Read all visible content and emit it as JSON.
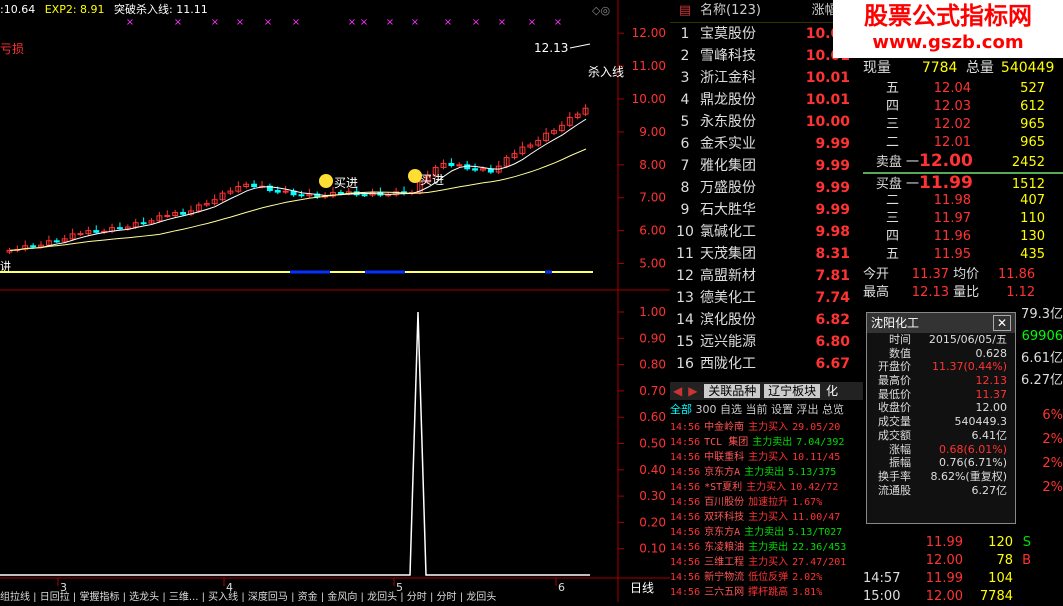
{
  "indicator": {
    "p1": ":10.64",
    "exp2": "EXP2: 8.91",
    "break_line": "突破杀入线: 11.11",
    "left_tag": "亏损"
  },
  "chart_data": {
    "type": "candlestick",
    "price_axis": [
      "12.00",
      "11.00",
      "10.00",
      "9.00",
      "8.00",
      "7.00",
      "6.00",
      "5.00"
    ],
    "ylim": [
      4.5,
      12.4
    ],
    "osc_axis": [
      "1.00",
      "0.90",
      "0.80",
      "0.70",
      "0.60",
      "0.50",
      "0.40",
      "0.30",
      "0.20",
      "0.10"
    ],
    "high_label": "12.13",
    "annotations": [
      "买进",
      "买进",
      "杀入线"
    ],
    "left_marker": "讲",
    "x_labels": [
      "3",
      "4",
      "5",
      "6"
    ],
    "period_label": "日线",
    "bottom_tabs": "组拉线 | 日回拉 | 掌握指标 | 选龙头 | 三维... | 买入线 | 深度回马 | 资金 | 金风向 | 龙回头 | 分时 | 分时 | 龙回头"
  },
  "watchlist": {
    "header_name": "名称(123)",
    "header_pct": "涨幅%",
    "rows": [
      {
        "n": "1",
        "name": "宝莫股份",
        "pct": "10.03"
      },
      {
        "n": "2",
        "name": "雪峰科技",
        "pct": "10.01"
      },
      {
        "n": "3",
        "name": "浙江金科",
        "pct": "10.01"
      },
      {
        "n": "4",
        "name": "鼎龙股份",
        "pct": "10.01"
      },
      {
        "n": "5",
        "name": "永东股份",
        "pct": "10.00"
      },
      {
        "n": "6",
        "name": "金禾实业",
        "pct": "9.99"
      },
      {
        "n": "7",
        "name": "雅化集团",
        "pct": "9.99"
      },
      {
        "n": "8",
        "name": "万盛股份",
        "pct": "9.99"
      },
      {
        "n": "9",
        "name": "石大胜华",
        "pct": "9.99"
      },
      {
        "n": "10",
        "name": "氯碱化工",
        "pct": "9.98"
      },
      {
        "n": "11",
        "name": "天茂集团",
        "pct": "8.31"
      },
      {
        "n": "12",
        "name": "高盟新材",
        "pct": "7.81"
      },
      {
        "n": "13",
        "name": "德美化工",
        "pct": "7.74"
      },
      {
        "n": "14",
        "name": "滨化股份",
        "pct": "6.82"
      },
      {
        "n": "15",
        "name": "远兴能源",
        "pct": "6.80"
      },
      {
        "n": "16",
        "name": "西陇化工",
        "pct": "6.67"
      }
    ]
  },
  "tabs": {
    "t1": "关联品种",
    "t2": "辽宁板块",
    "t3": "化"
  },
  "subtabs": {
    "a": "全部",
    "b": "300",
    "c": "自选",
    "d": "当前",
    "e": "设置",
    "f": "浮出",
    "g": "总览"
  },
  "ticks": [
    {
      "t": "14:56",
      "s": "中金岭南",
      "a": "主力买入",
      "v": "29.05/20"
    },
    {
      "t": "14:56",
      "s": "TCL 集团",
      "a": "主力卖出",
      "v": "7.04/392"
    },
    {
      "t": "14:56",
      "s": "中联重科",
      "a": "主力买入",
      "v": "10.11/45"
    },
    {
      "t": "14:56",
      "s": "京东方A",
      "a": "主力卖出",
      "v": "5.13/375"
    },
    {
      "t": "14:56",
      "s": "*ST夏利",
      "a": "主力买入",
      "v": "10.42/72"
    },
    {
      "t": "14:56",
      "s": "百川股份",
      "a": "加速拉升",
      "v": "1.67%"
    },
    {
      "t": "14:56",
      "s": "双环科技",
      "a": "主力买入",
      "v": "11.00/47"
    },
    {
      "t": "14:56",
      "s": "京东方A",
      "a": "主力卖出",
      "v": "5.13/T027"
    },
    {
      "t": "14:56",
      "s": "东凌粮油",
      "a": "主力卖出",
      "v": "22.36/453"
    },
    {
      "t": "14:56",
      "s": "三维工程",
      "a": "主力买入",
      "v": "27.47/201"
    },
    {
      "t": "14:56",
      "s": "新宁物流",
      "a": "低位反弹",
      "v": "2.02%"
    },
    {
      "t": "14:56",
      "s": "三六五网",
      "a": "撑杆跳高",
      "v": "3.81%"
    }
  ],
  "banner": {
    "title": "股票公式指标网",
    "url": "www.gszb.com"
  },
  "quote": {
    "now_vol_label": "现量",
    "now_vol": "7784",
    "total_label": "总量",
    "total": "540449",
    "sell": [
      {
        "l": "五",
        "p": "12.04",
        "v": "527"
      },
      {
        "l": "四",
        "p": "12.03",
        "v": "612"
      },
      {
        "l": "三",
        "p": "12.02",
        "v": "965"
      },
      {
        "l": "二",
        "p": "12.01",
        "v": "965"
      },
      {
        "l": "卖盘 一",
        "p": "12.00",
        "v": "2452"
      }
    ],
    "buy": [
      {
        "l": "买盘 一",
        "p": "11.99",
        "v": "1512"
      },
      {
        "l": "二",
        "p": "11.98",
        "v": "407"
      },
      {
        "l": "三",
        "p": "11.97",
        "v": "110"
      },
      {
        "l": "四",
        "p": "11.96",
        "v": "130"
      },
      {
        "l": "五",
        "p": "11.95",
        "v": "435"
      }
    ],
    "open_label": "今开",
    "open": "11.37",
    "avg_label": "均价",
    "avg": "11.86",
    "high_label": "最高",
    "high": "12.13",
    "ratio_label": "量比",
    "ratio": "1.12",
    "side": [
      "79.3亿",
      "69906",
      "6.61亿",
      "6.27亿"
    ],
    "right_pct": [
      "6%",
      "2%",
      "2%",
      "2%"
    ],
    "bottom_ticks": [
      {
        "t": "",
        "p": "11.99",
        "v": "120",
        "f": "S"
      },
      {
        "t": "",
        "p": "12.00",
        "v": "78",
        "f": "B"
      },
      {
        "t": "14:57",
        "p": "11.99",
        "v": "104",
        "f": ""
      },
      {
        "t": "15:00",
        "p": "12.00",
        "v": "7784",
        "f": ""
      }
    ]
  },
  "popup": {
    "title": "沈阳化工",
    "rows": [
      {
        "k": "时间",
        "v": "2015/06/05/五"
      },
      {
        "k": "数值",
        "v": "0.628"
      },
      {
        "k": "开盘价",
        "v": "11.37(0.44%)"
      },
      {
        "k": "最高价",
        "v": "12.13"
      },
      {
        "k": "最低价",
        "v": "11.37"
      },
      {
        "k": "收盘价",
        "v": "12.00"
      },
      {
        "k": "成交量",
        "v": "540449.3"
      },
      {
        "k": "成交额",
        "v": "6.41亿"
      },
      {
        "k": "涨幅",
        "v": "0.68(6.01%)"
      },
      {
        "k": "振幅",
        "v": "0.76(6.71%)"
      },
      {
        "k": "换手率",
        "v": "8.62%(重复权)"
      },
      {
        "k": "流通股",
        "v": "6.27亿"
      }
    ]
  },
  "colors": {
    "up": "#ff3333",
    "down": "#00ffff",
    "ma1": "#ffffff",
    "ma2": "#ffff99",
    "axis": "#aa0000"
  }
}
